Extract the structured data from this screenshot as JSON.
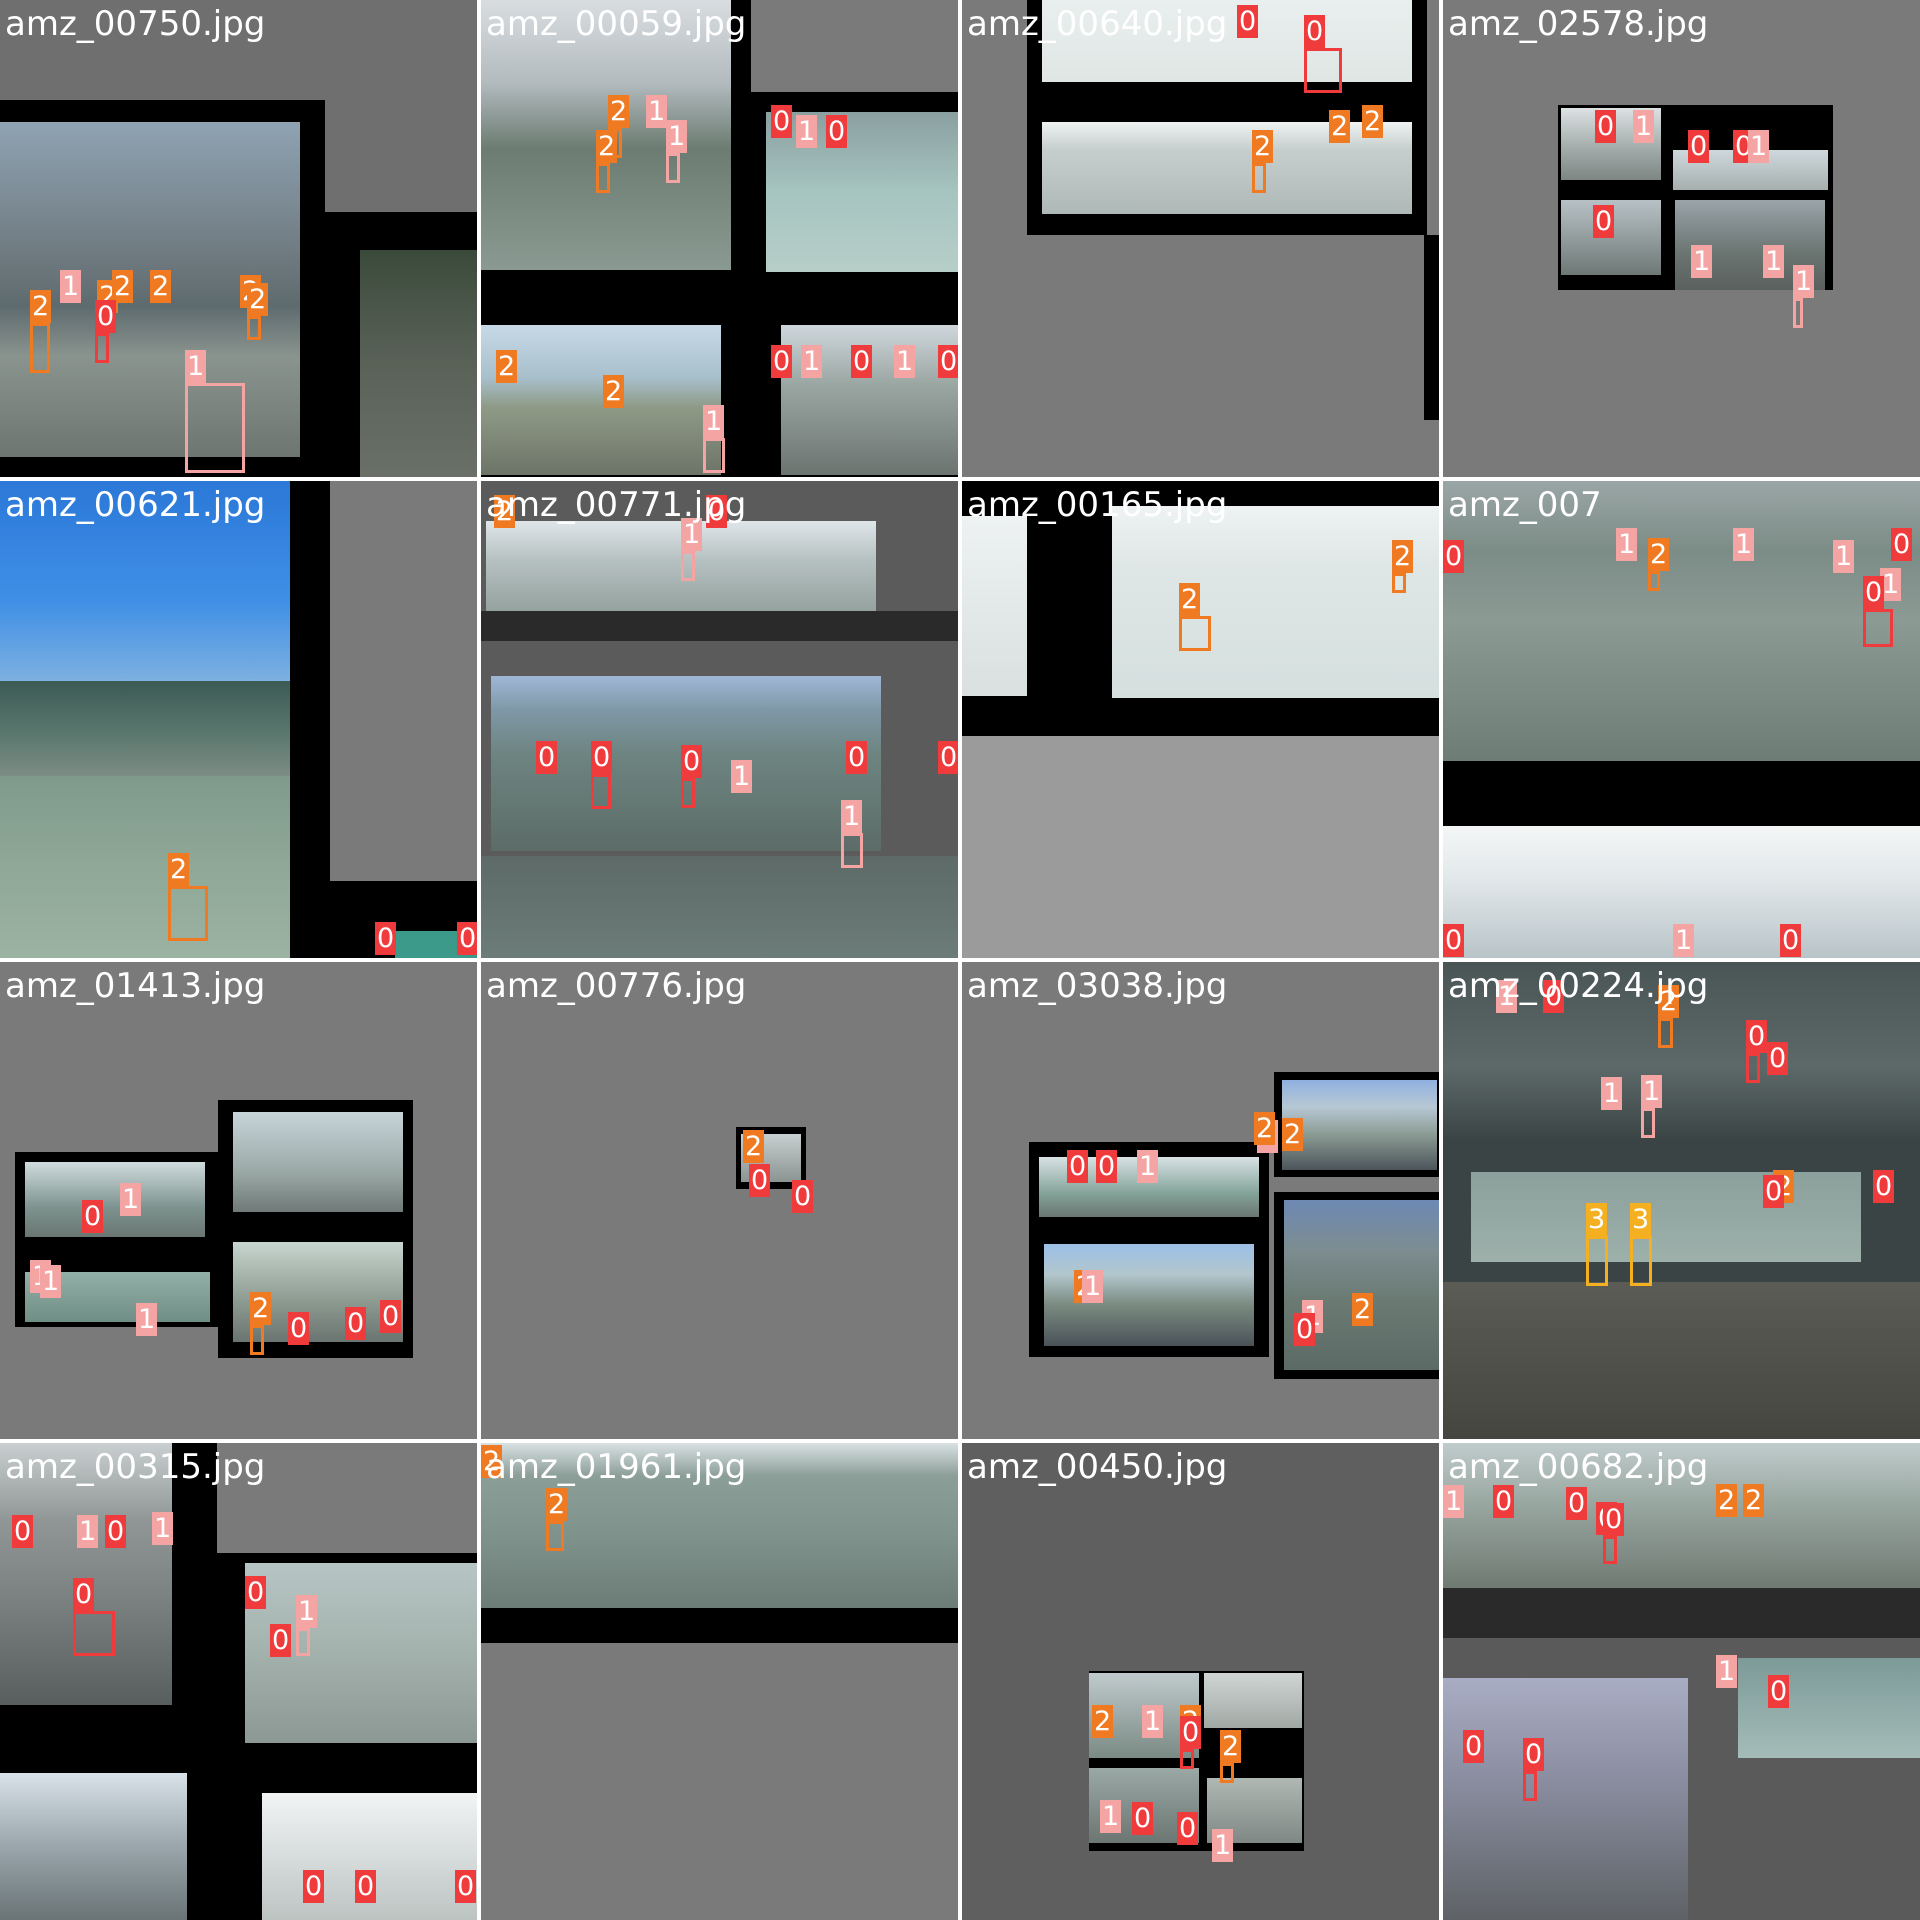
{
  "colors": {
    "class_0": "#ef3b3b",
    "class_1": "#f5a4a4",
    "class_2": "#f07a22",
    "class_3": "#f4b021",
    "title_text": "#ffffff",
    "pad_gray": "#7a7a7a",
    "black": "#000000"
  },
  "tiles": [
    {
      "title": "amz_00750.jpg",
      "labels": [
        {
          "text": "2",
          "cls": 2
        },
        {
          "text": "1",
          "cls": 1
        },
        {
          "text": "2",
          "cls": 2
        },
        {
          "text": "2",
          "cls": 2
        },
        {
          "text": "2",
          "cls": 2
        },
        {
          "text": "0",
          "cls": 0
        },
        {
          "text": "1",
          "cls": 1
        },
        {
          "text": "2",
          "cls": 2
        },
        {
          "text": "2",
          "cls": 2
        }
      ]
    },
    {
      "title": "amz_00059.jpg",
      "labels": [
        {
          "text": "2",
          "cls": 2
        },
        {
          "text": "1",
          "cls": 1
        },
        {
          "text": "1",
          "cls": 1
        },
        {
          "text": "2",
          "cls": 2
        },
        {
          "text": "0",
          "cls": 0
        },
        {
          "text": "1",
          "cls": 1
        },
        {
          "text": "0",
          "cls": 0
        },
        {
          "text": "2",
          "cls": 2
        },
        {
          "text": "2",
          "cls": 2
        },
        {
          "text": "1",
          "cls": 1
        },
        {
          "text": "0",
          "cls": 0
        },
        {
          "text": "1",
          "cls": 1
        },
        {
          "text": "0",
          "cls": 0
        },
        {
          "text": "1",
          "cls": 1
        },
        {
          "text": "0",
          "cls": 0
        }
      ]
    },
    {
      "title": "amz_00640.jpg",
      "labels": [
        {
          "text": "0",
          "cls": 0
        },
        {
          "text": "0",
          "cls": 0
        },
        {
          "text": "2",
          "cls": 2
        },
        {
          "text": "2",
          "cls": 2
        },
        {
          "text": "2",
          "cls": 2
        }
      ]
    },
    {
      "title": "amz_02578.jpg",
      "labels": [
        {
          "text": "0",
          "cls": 0
        },
        {
          "text": "1",
          "cls": 1
        },
        {
          "text": "0",
          "cls": 0
        },
        {
          "text": "0",
          "cls": 0
        },
        {
          "text": "1",
          "cls": 1
        },
        {
          "text": "0",
          "cls": 0
        },
        {
          "text": "1",
          "cls": 1
        },
        {
          "text": "1",
          "cls": 1
        },
        {
          "text": "1",
          "cls": 1
        }
      ]
    },
    {
      "title": "amz_00621.jpg",
      "labels": [
        {
          "text": "2",
          "cls": 2
        },
        {
          "text": "0",
          "cls": 0
        },
        {
          "text": "0",
          "cls": 0
        }
      ]
    },
    {
      "title": "amz_00771.jpg",
      "labels": [
        {
          "text": "2",
          "cls": 2
        },
        {
          "text": "0",
          "cls": 0
        },
        {
          "text": "1",
          "cls": 1
        },
        {
          "text": "0",
          "cls": 0
        },
        {
          "text": "0",
          "cls": 0
        },
        {
          "text": "0",
          "cls": 0
        },
        {
          "text": "0",
          "cls": 0
        },
        {
          "text": "1",
          "cls": 1
        },
        {
          "text": "0",
          "cls": 0
        },
        {
          "text": "1",
          "cls": 1
        }
      ]
    },
    {
      "title": "amz_00165.jpg",
      "labels": [
        {
          "text": "2",
          "cls": 2
        },
        {
          "text": "2",
          "cls": 2
        }
      ]
    },
    {
      "title": "amz_007",
      "labels": [
        {
          "text": "0",
          "cls": 0
        },
        {
          "text": "1",
          "cls": 1
        },
        {
          "text": "2",
          "cls": 2
        },
        {
          "text": "1",
          "cls": 1
        },
        {
          "text": "1",
          "cls": 1
        },
        {
          "text": "1",
          "cls": 1
        },
        {
          "text": "0",
          "cls": 0
        },
        {
          "text": "0",
          "cls": 0
        },
        {
          "text": "0",
          "cls": 0
        },
        {
          "text": "1",
          "cls": 1
        },
        {
          "text": "0",
          "cls": 0
        }
      ]
    },
    {
      "title": "amz_01413.jpg",
      "labels": [
        {
          "text": "1",
          "cls": 1
        },
        {
          "text": "0",
          "cls": 0
        },
        {
          "text": "1",
          "cls": 1
        },
        {
          "text": "1",
          "cls": 1
        },
        {
          "text": "1",
          "cls": 1
        },
        {
          "text": "2",
          "cls": 2
        },
        {
          "text": "0",
          "cls": 0
        },
        {
          "text": "0",
          "cls": 0
        },
        {
          "text": "0",
          "cls": 0
        }
      ]
    },
    {
      "title": "amz_00776.jpg",
      "labels": [
        {
          "text": "2",
          "cls": 2
        },
        {
          "text": "0",
          "cls": 0
        },
        {
          "text": "0",
          "cls": 0
        }
      ]
    },
    {
      "title": "amz_03038.jpg",
      "labels": [
        {
          "text": "0",
          "cls": 0
        },
        {
          "text": "0",
          "cls": 0
        },
        {
          "text": "1",
          "cls": 1
        },
        {
          "text": "2",
          "cls": 2
        },
        {
          "text": "1",
          "cls": 1
        },
        {
          "text": "1",
          "cls": 1
        },
        {
          "text": "2",
          "cls": 2
        },
        {
          "text": "2",
          "cls": 2
        },
        {
          "text": "1",
          "cls": 1
        },
        {
          "text": "0",
          "cls": 0
        },
        {
          "text": "2",
          "cls": 2
        }
      ]
    },
    {
      "title": "amz_00224.jpg",
      "labels": [
        {
          "text": "1",
          "cls": 1
        },
        {
          "text": "0",
          "cls": 0
        },
        {
          "text": "1",
          "cls": 1
        },
        {
          "text": "2",
          "cls": 2
        },
        {
          "text": "0",
          "cls": 0
        },
        {
          "text": "0",
          "cls": 0
        },
        {
          "text": "1",
          "cls": 1
        },
        {
          "text": "3",
          "cls": 3
        },
        {
          "text": "3",
          "cls": 3
        },
        {
          "text": "2",
          "cls": 2
        },
        {
          "text": "0",
          "cls": 0
        },
        {
          "text": "0",
          "cls": 0
        }
      ]
    },
    {
      "title": "amz_00315.jpg",
      "labels": [
        {
          "text": "0",
          "cls": 0
        },
        {
          "text": "1",
          "cls": 1
        },
        {
          "text": "0",
          "cls": 0
        },
        {
          "text": "1",
          "cls": 1
        },
        {
          "text": "0",
          "cls": 0
        },
        {
          "text": "0",
          "cls": 0
        },
        {
          "text": "1",
          "cls": 1
        },
        {
          "text": "0",
          "cls": 0
        },
        {
          "text": "0",
          "cls": 0
        },
        {
          "text": "0",
          "cls": 0
        },
        {
          "text": "0",
          "cls": 0
        }
      ]
    },
    {
      "title": "amz_01961.jpg",
      "labels": [
        {
          "text": "2",
          "cls": 2
        },
        {
          "text": "2",
          "cls": 2
        }
      ]
    },
    {
      "title": "amz_00450.jpg",
      "labels": [
        {
          "text": "2",
          "cls": 2
        },
        {
          "text": "1",
          "cls": 1
        },
        {
          "text": "2",
          "cls": 2
        },
        {
          "text": "0",
          "cls": 0
        },
        {
          "text": "2",
          "cls": 2
        },
        {
          "text": "1",
          "cls": 1
        },
        {
          "text": "0",
          "cls": 0
        },
        {
          "text": "0",
          "cls": 0
        },
        {
          "text": "1",
          "cls": 1
        }
      ]
    },
    {
      "title": "amz_00682.jpg",
      "labels": [
        {
          "text": "1",
          "cls": 1
        },
        {
          "text": "0",
          "cls": 0
        },
        {
          "text": "0",
          "cls": 0
        },
        {
          "text": "0",
          "cls": 0
        },
        {
          "text": "2",
          "cls": 2
        },
        {
          "text": "2",
          "cls": 2
        },
        {
          "text": "0",
          "cls": 0
        },
        {
          "text": "1",
          "cls": 1
        },
        {
          "text": "0",
          "cls": 0
        },
        {
          "text": "0",
          "cls": 0
        },
        {
          "text": "0",
          "cls": 0
        }
      ]
    }
  ]
}
